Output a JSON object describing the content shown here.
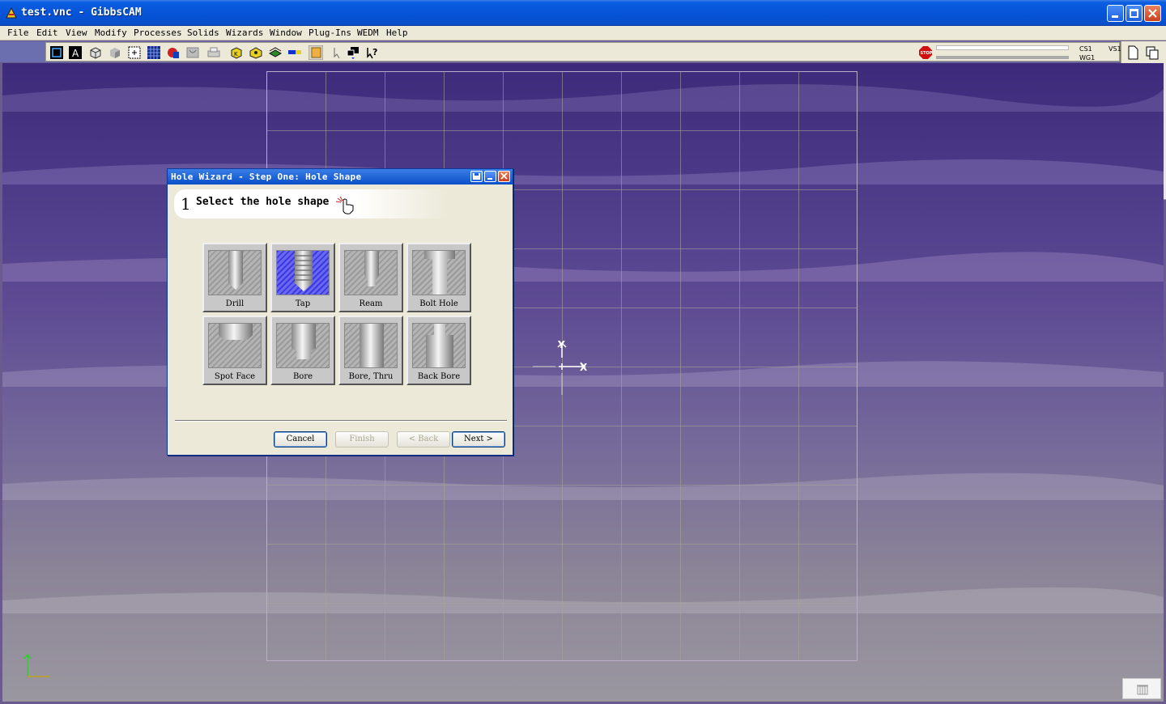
{
  "window": {
    "title": "test.vnc - GibbsCAM"
  },
  "menu": [
    "File",
    "Edit",
    "View",
    "Modify",
    "Processes",
    "Solids",
    "Wizards",
    "Window",
    "Plug-Ins",
    "WEDM",
    "Help"
  ],
  "status": {
    "cs": "CS1",
    "wg": "WG1",
    "vs": "VS1"
  },
  "dialog": {
    "title": "Hole Wizard - Step One: Hole Shape",
    "step_number": "1",
    "step_text": "Select the hole shape",
    "shapes": [
      {
        "label": "Drill",
        "selected": false
      },
      {
        "label": "Tap",
        "selected": true
      },
      {
        "label": "Ream",
        "selected": false
      },
      {
        "label": "Bolt Hole",
        "selected": false
      },
      {
        "label": "Spot Face",
        "selected": false
      },
      {
        "label": "Bore",
        "selected": false
      },
      {
        "label": "Bore, Thru",
        "selected": false
      },
      {
        "label": "Back Bore",
        "selected": false
      }
    ],
    "buttons": {
      "cancel": "Cancel",
      "finish": "Finish",
      "back": "< Back",
      "next": "Next >"
    }
  },
  "axes": {
    "x": "X",
    "y": "Y"
  },
  "colors": {
    "accent": "#0a4fc8",
    "selected_shape": "#3b3ae0",
    "dialog_bg": "#ece9d8"
  }
}
